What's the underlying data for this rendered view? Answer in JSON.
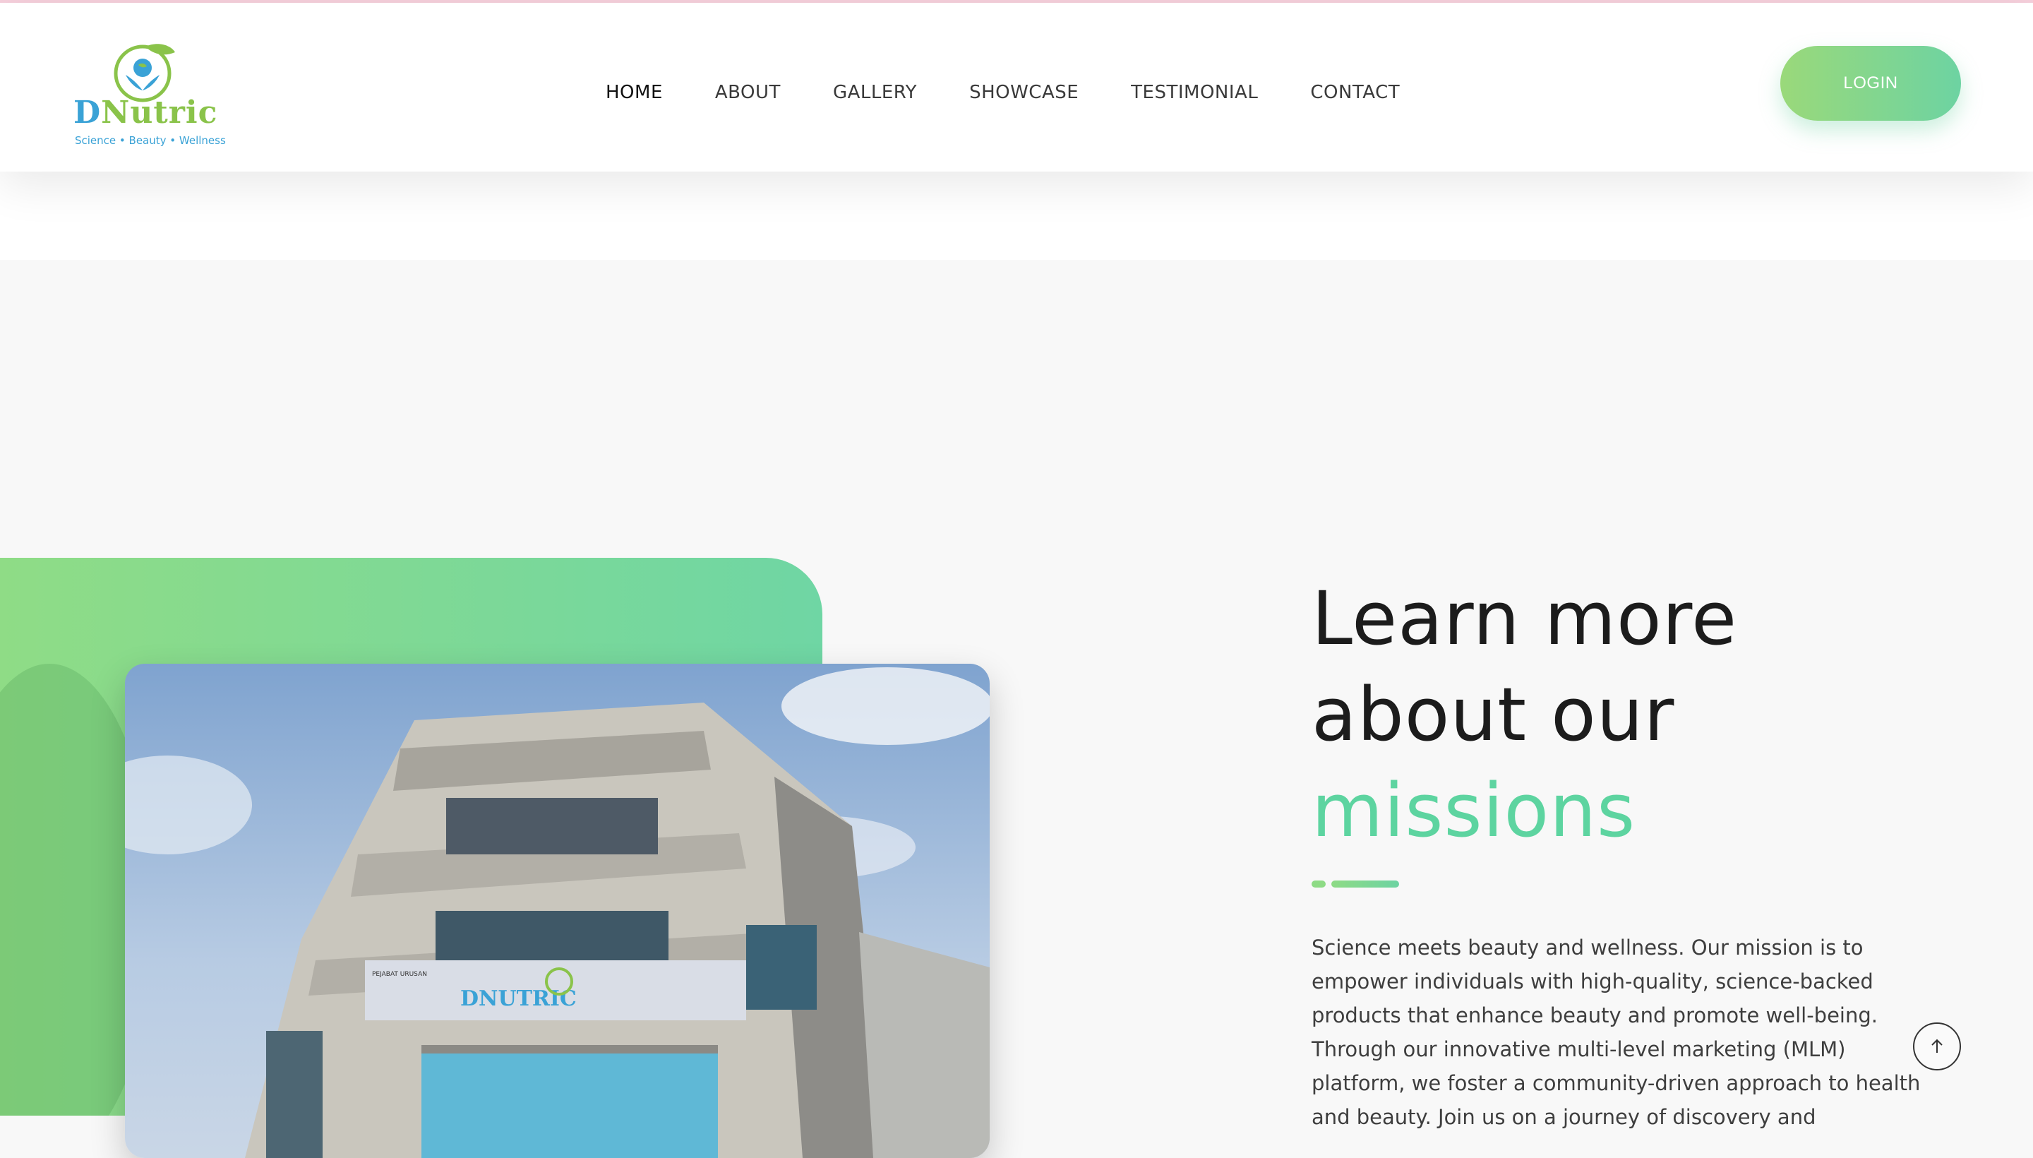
{
  "brand": {
    "name_initial": "D",
    "name_rest": "Nutric",
    "tagline": "Science • Beauty • Wellness",
    "logo_icon": "leaf-globe-hands-logo",
    "colors": {
      "blue": "#3aa2d6",
      "green": "#8ac34a"
    }
  },
  "nav": {
    "items": [
      {
        "label": "HOME",
        "active": true
      },
      {
        "label": "ABOUT",
        "active": false
      },
      {
        "label": "GALLERY",
        "active": false
      },
      {
        "label": "SHOWCASE",
        "active": false
      },
      {
        "label": "TESTIMONIAL",
        "active": false
      },
      {
        "label": "CONTACT",
        "active": false
      }
    ],
    "login_label": "LOGIN"
  },
  "about": {
    "headline_line1": "Learn more",
    "headline_line2": "about our",
    "headline_accent": "missions",
    "body": "Science meets beauty and wellness. Our mission is to empower individuals with high-quality, science-backed products that enhance beauty and promote well-being. Through our innovative multi-level marketing (MLM) platform, we foster a community-driven approach to health and beauty. Join us on a journey of discovery and",
    "photo": {
      "signage_text": "DNUTRIC",
      "signage_small": "PEJABAT URUSAN",
      "icon": "office-building-photo"
    }
  },
  "scroll_to_top": {
    "icon": "arrow-up-icon"
  },
  "theme": {
    "accent": "#5dd4a0",
    "gradient_start": "#9ad97a",
    "gradient_end": "#6dd3a2",
    "top_line": "#f6d0dc"
  }
}
